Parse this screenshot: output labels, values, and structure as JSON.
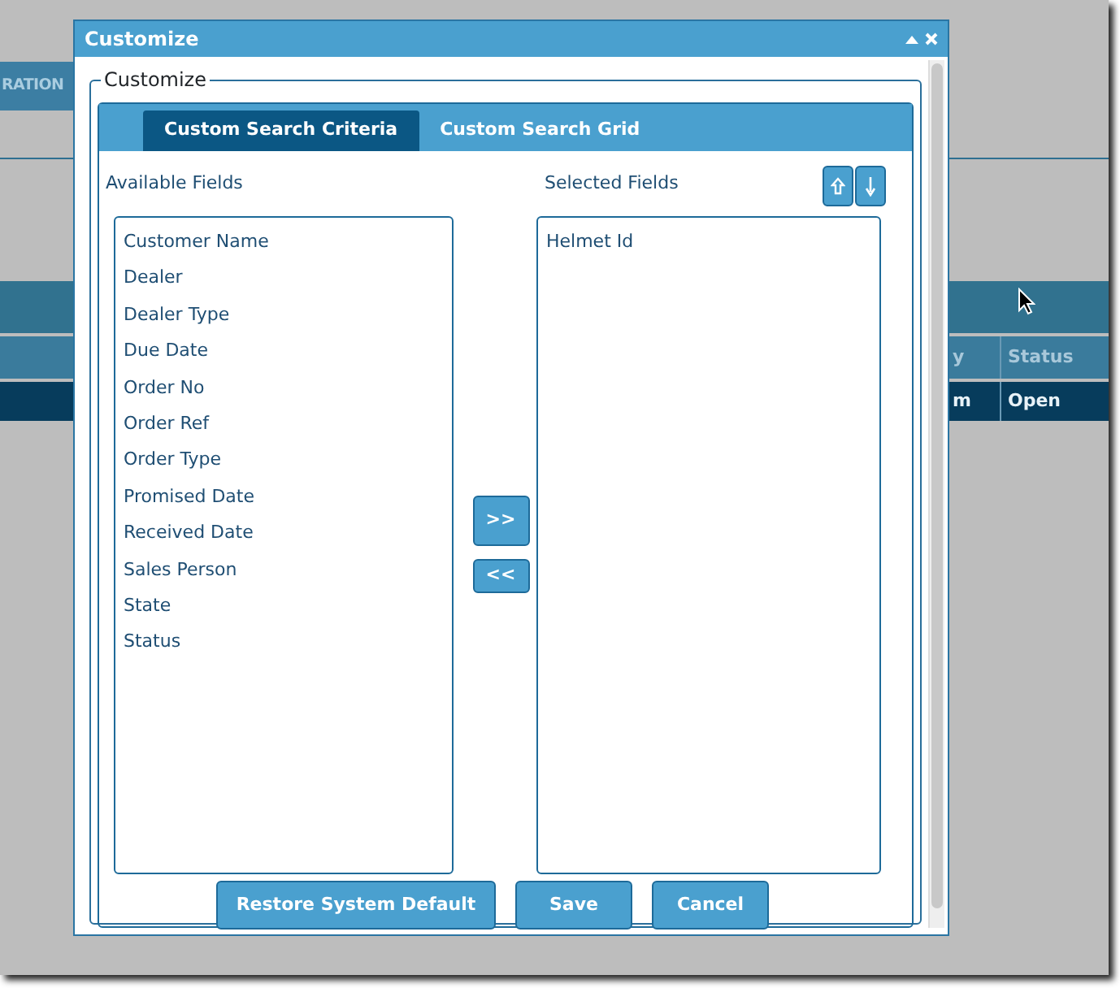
{
  "background": {
    "tab_label": "RATION",
    "table_header": [
      "y",
      "Status"
    ],
    "table_row": [
      "m",
      "Open"
    ]
  },
  "dialog": {
    "title": "Customize",
    "legend": "Customize",
    "tabs": [
      {
        "label": "Custom Search Criteria",
        "selected": true
      },
      {
        "label": "Custom Search Grid",
        "selected": false
      }
    ],
    "available_label": "Available Fields",
    "selected_label": "Selected Fields",
    "available_fields": [
      "Customer Name",
      "Dealer",
      "Dealer Type",
      "Due Date",
      "Order No",
      "Order Ref",
      "Order Type",
      "Promised Date",
      "Received Date",
      "Sales Person",
      "State",
      "Status"
    ],
    "selected_fields": [
      "Helmet Id"
    ],
    "move_buttons": [
      ">>",
      "<<"
    ],
    "footer_buttons": [
      "Restore System Default",
      "Save",
      "Cancel"
    ]
  }
}
